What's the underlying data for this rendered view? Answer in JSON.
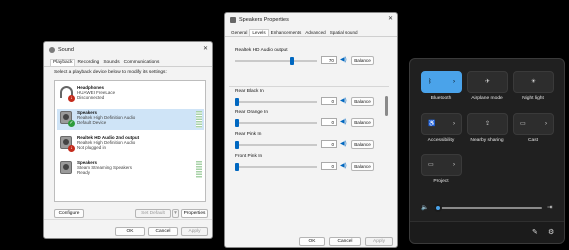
{
  "sound": {
    "title": "Sound",
    "close": "✕",
    "tabs": [
      "Playback",
      "Recording",
      "Sounds",
      "Communications"
    ],
    "description": "Select a playback device below to modify its settings:",
    "devices": [
      {
        "name": "Headphones",
        "line1": "HUAWEI FreeLace",
        "line2": "Disconnected",
        "badge": "↓"
      },
      {
        "name": "Speakers",
        "line1": "Realtek High Definition Audio",
        "line2": "Default Device",
        "badge": "✓"
      },
      {
        "name": "Realtek HD Audio 2nd output",
        "line1": "Realtek High Definition Audio",
        "line2": "Not plugged in",
        "badge": "↓"
      },
      {
        "name": "Speakers",
        "line1": "Steam Streaming Speakers",
        "line2": "Ready",
        "badge": ""
      }
    ],
    "configure": "Configure",
    "set_default": "Set Default",
    "set_default_arrow": "▼",
    "properties": "Properties",
    "ok": "OK",
    "cancel": "Cancel",
    "apply": "Apply"
  },
  "props": {
    "title": "Speakers Properties",
    "close": "✕",
    "tabs": [
      "General",
      "Levels",
      "Enhancements",
      "Advanced",
      "Spatial sound"
    ],
    "levels": [
      {
        "name": "Realtek HD Audio output",
        "value": "70",
        "level": 0.7
      },
      {
        "name": "Rear Black In",
        "value": "0",
        "level": 0
      },
      {
        "name": "Rear Orange In",
        "value": "0",
        "level": 0
      },
      {
        "name": "Rear Pink In",
        "value": "0",
        "level": 0
      },
      {
        "name": "Front Pink In",
        "value": "0",
        "level": 0
      }
    ],
    "balance": "Balance",
    "ok": "OK",
    "cancel": "Cancel",
    "apply": "Apply"
  },
  "quick": {
    "tiles": [
      {
        "label": "Bluetooth",
        "icon": "bluetooth-icon",
        "glyph": "ᛒ",
        "arrow": "›",
        "on": true
      },
      {
        "label": "Airplane mode",
        "icon": "airplane-icon",
        "glyph": "✈",
        "arrow": "",
        "on": false
      },
      {
        "label": "Night light",
        "icon": "night-light-icon",
        "glyph": "☀",
        "arrow": "",
        "on": false
      },
      {
        "label": "Accessibility",
        "icon": "accessibility-icon",
        "glyph": "♿",
        "arrow": "›",
        "on": false
      },
      {
        "label": "Nearby sharing",
        "icon": "share-icon",
        "glyph": "⇪",
        "arrow": "",
        "on": false
      },
      {
        "label": "Cast",
        "icon": "cast-icon",
        "glyph": "▭",
        "arrow": "›",
        "on": false
      },
      {
        "label": "Project",
        "icon": "project-icon",
        "glyph": "▭",
        "arrow": "›",
        "on": false
      }
    ],
    "volume_level": 0.04,
    "volume_icon": "speaker-icon",
    "volume_glyph": "🔈",
    "output_glyph": "⇥",
    "edit_glyph": "✎",
    "settings_glyph": "⚙",
    "accent": "#4aa3ea"
  }
}
